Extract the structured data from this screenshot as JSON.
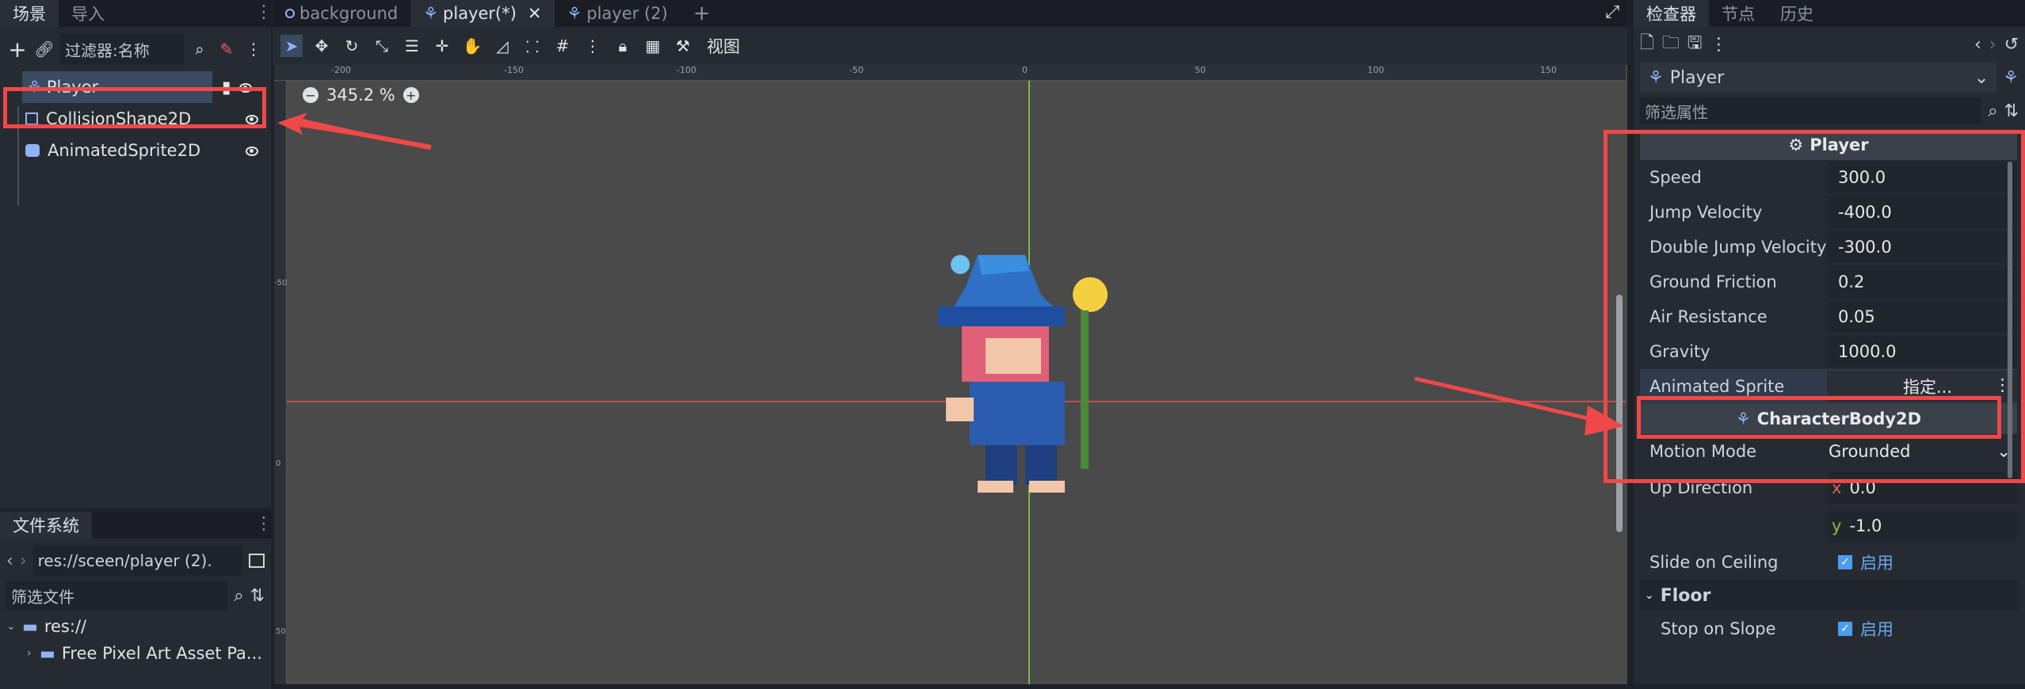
{
  "left_panel": {
    "tabs": [
      "场景",
      "导入"
    ],
    "filter_placeholder": "过滤器:名称",
    "tree": [
      {
        "label": "Player",
        "icon": "character-body-icon"
      },
      {
        "label": "CollisionShape2D",
        "icon": "collision-shape-icon"
      },
      {
        "label": "AnimatedSprite2D",
        "icon": "animated-sprite-icon"
      }
    ]
  },
  "filesystem": {
    "tab": "文件系统",
    "path": "res://sceen/player (2).",
    "filter_placeholder": "筛选文件",
    "items": [
      "res://",
      "Free Pixel Art Asset Pa..."
    ]
  },
  "editor_tabs": [
    {
      "label": "background",
      "icon": "circle-icon"
    },
    {
      "label": "player(*)",
      "icon": "character-body-icon",
      "active": true
    },
    {
      "label": "player (2)",
      "icon": "character-body-icon"
    }
  ],
  "toolbar": {
    "view_label": "视图"
  },
  "viewport": {
    "zoom": "345.2 %",
    "ruler_h": [
      "-200",
      "-150",
      "-100",
      "-50",
      "0",
      "50",
      "100",
      "150"
    ],
    "ruler_v": [
      "-50",
      "0",
      "50"
    ]
  },
  "inspector": {
    "tabs": [
      "检查器",
      "节点",
      "历史"
    ],
    "node_name": "Player",
    "filter_placeholder": "筛选属性",
    "section_player": "Player",
    "properties": [
      {
        "label": "Speed",
        "value": "300.0"
      },
      {
        "label": "Jump Velocity",
        "value": "-400.0"
      },
      {
        "label": "Double Jump Velocity",
        "value": "-300.0"
      },
      {
        "label": "Ground Friction",
        "value": "0.2"
      },
      {
        "label": "Air Resistance",
        "value": "0.05"
      },
      {
        "label": "Gravity",
        "value": "1000.0"
      }
    ],
    "animated_sprite": {
      "label": "Animated Sprite",
      "value": "指定..."
    },
    "section_body": "CharacterBody2D",
    "motion_mode": {
      "label": "Motion Mode",
      "value": "Grounded"
    },
    "up_direction": {
      "label": "Up Direction",
      "x": "0.0",
      "y": "-1.0"
    },
    "slide_on_ceiling": {
      "label": "Slide on Ceiling",
      "value": "启用"
    },
    "floor_section": "Floor",
    "stop_on_slope": {
      "label": "Stop on Slope",
      "value": "启用"
    }
  },
  "colors": {
    "accent": "#4a9df0",
    "annotation": "#f04848"
  }
}
